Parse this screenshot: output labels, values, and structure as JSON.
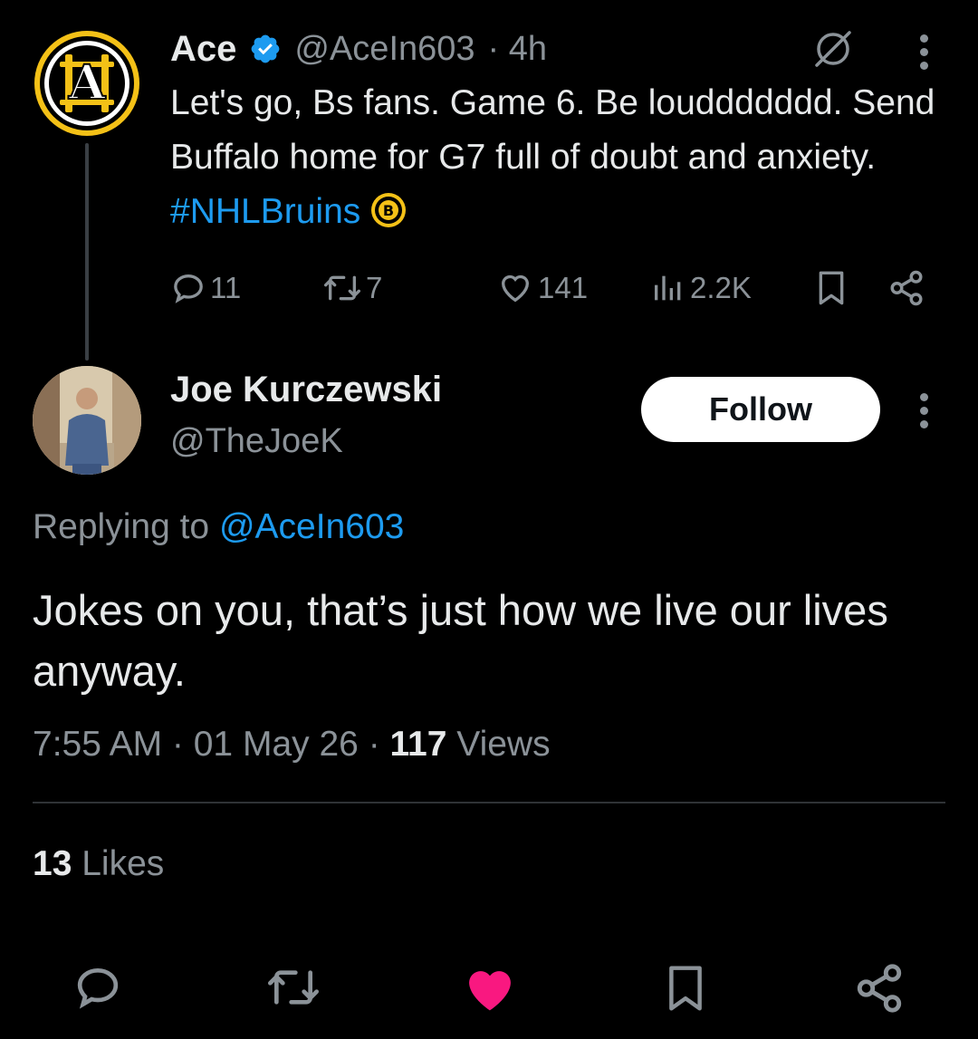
{
  "parent_tweet": {
    "display_name": "Ace",
    "handle": "@AceIn603",
    "time": "· 4h",
    "text": "Let's go, Bs fans. Game 6. Be louddddddd. Send Buffalo home for G7 full of doubt and anxiety. ",
    "hashtag": "#NHLBruins",
    "avatar_letter": "A",
    "emoji_letter": "B",
    "metrics": {
      "replies": "11",
      "retweets": "7",
      "likes": "141",
      "views": "2.2K"
    }
  },
  "reply": {
    "display_name": "Joe Kurczewski",
    "handle": "@TheJoeK",
    "follow_label": "Follow",
    "replying_to_prefix": "Replying to ",
    "replying_to_handle": "@AceIn603",
    "text": "Jokes on you, that’s just how we live our lives anyway.",
    "timestamp": "7:55 AM · 01 May 26 · ",
    "views_count": "117",
    "views_label": " Views",
    "likes_count": "13",
    "likes_label": " Likes"
  },
  "colors": {
    "background": "#000000",
    "text": "#e7e9ea",
    "muted": "#8b9298",
    "link": "#1d9bf0",
    "verified": "#1d9bf0",
    "liked": "#f91880"
  },
  "icons": [
    "verified-badge-icon",
    "grok-icon",
    "more-icon",
    "reply-icon",
    "retweet-icon",
    "like-icon",
    "views-icon",
    "bookmark-icon",
    "share-icon"
  ]
}
